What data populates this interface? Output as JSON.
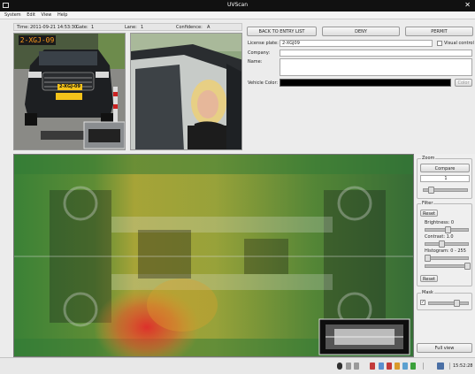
{
  "window": {
    "title": "UVScan",
    "close_glyph": "✕"
  },
  "menu": [
    "System",
    "Edit",
    "View",
    "Help"
  ],
  "info": {
    "time_label": "Time:",
    "time_value": "2011-09-21 14:53:30",
    "gate_label": "Gate:",
    "gate_value": "1",
    "lane_label": "Lane:",
    "lane_value": "1",
    "confidence_label": "Confidence:",
    "confidence_value": "A"
  },
  "plates": {
    "overlay_plate": "2-XGJ-09",
    "car_plate": "2-XGJ-09"
  },
  "actions": {
    "back_label": "BACK TO ENTRY LIST",
    "deny_label": "DENY",
    "permit_label": "PERMIT"
  },
  "form": {
    "license_label": "License plate:",
    "license_value": "2-XGJ09",
    "visual_check_label": "Visual control",
    "visual_check_checked": false,
    "company_label": "Company:",
    "company_value": "",
    "name_label": "Name:",
    "name_value": "",
    "vehicle_color_label": "Vehicle Color:",
    "vehicle_color_value": "#000000",
    "color_button_label": "Color"
  },
  "zoom": {
    "group_title": "Zoom",
    "compare_label": "Compare",
    "zoom_value": "1",
    "slider_level": 0.12
  },
  "filter": {
    "group_title": "Filter",
    "reset_top_label": "Reset",
    "brightness_label": "Brightness: 0",
    "brightness_level": 0.5,
    "contrast_label": "Contrast: 1.0",
    "contrast_level": 0.35,
    "histogram_label": "Histogram: 0 - 255",
    "histogram_low": 0.0,
    "histogram_high": 1.0,
    "reset_bottom_label": "Reset"
  },
  "mask": {
    "group_title": "Mask",
    "checked": true,
    "slider_level": 0.7
  },
  "full_view_label": "Full view",
  "status": {
    "clock": "15:52:28"
  }
}
